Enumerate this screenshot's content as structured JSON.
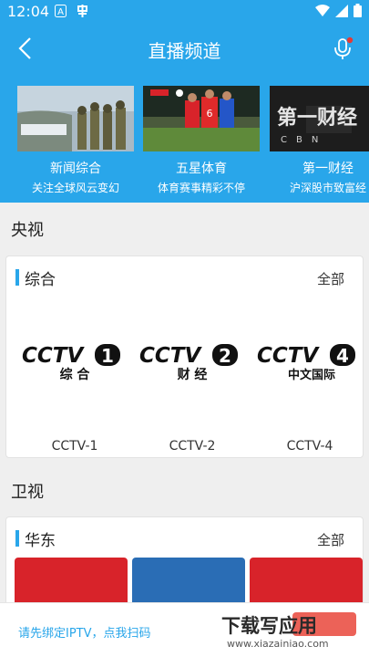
{
  "status_bar": {
    "time": "12:04"
  },
  "header": {
    "title": "直播频道"
  },
  "featured": [
    {
      "name": "新闻综合",
      "desc": "关注全球风云变幻",
      "icon": "military-news-thumbnail"
    },
    {
      "name": "五星体育",
      "desc": "体育赛事精彩不停",
      "icon": "football-thumbnail"
    },
    {
      "name": "第一财经",
      "desc": "沪深股市致富经",
      "icon": "cbn-logo-thumbnail"
    }
  ],
  "section_cctv": {
    "title": "央视"
  },
  "panel_cctv": {
    "label": "综合",
    "all": "全部",
    "channels": [
      {
        "name": "CCTV-1",
        "logo_number": "1",
        "logo_caption": "综 合"
      },
      {
        "name": "CCTV-2",
        "logo_number": "2",
        "logo_caption": "财 经"
      },
      {
        "name": "CCTV-4",
        "logo_number": "4",
        "logo_caption": "中文国际"
      }
    ]
  },
  "section_satellite": {
    "title": "卫视"
  },
  "panel_east": {
    "label": "华东",
    "all": "全部"
  },
  "bottom": {
    "hint": "请先绑定IPTV，点我扫码",
    "watermark_cn": "下载写应用",
    "watermark_url": "www.xiazainiao.com"
  },
  "colors": {
    "accent": "#29a6ea",
    "tile_red": "#d8232a",
    "tile_blue": "#2a6db5"
  }
}
